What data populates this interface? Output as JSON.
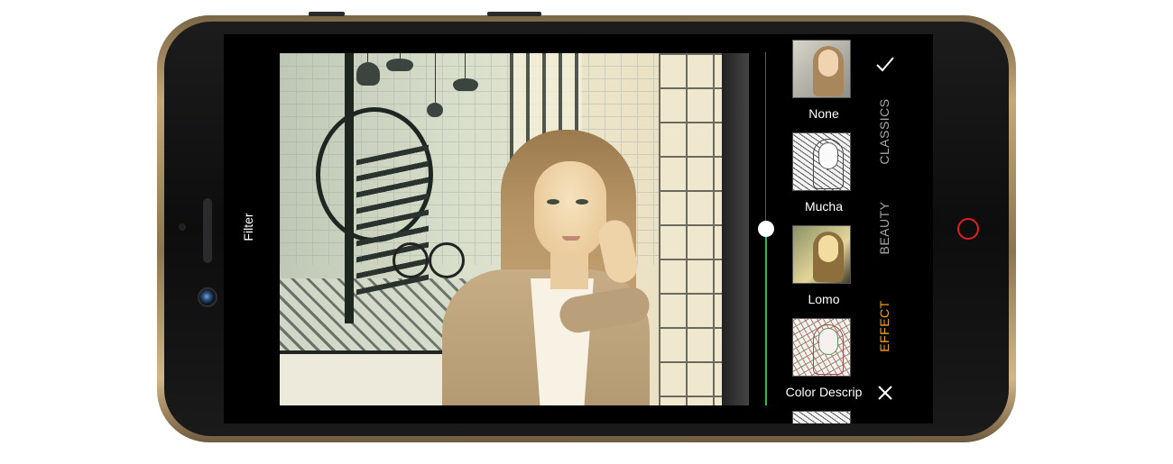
{
  "screen": {
    "title": "Filter"
  },
  "filters": {
    "items": [
      {
        "label": "None"
      },
      {
        "label": "Mucha"
      },
      {
        "label": "Lomo"
      },
      {
        "label": "Color Descrip"
      }
    ]
  },
  "categories": {
    "items": [
      {
        "label": "CLASSICS"
      },
      {
        "label": "BEAUTY"
      },
      {
        "label": "EFFECT"
      }
    ],
    "active": "EFFECT"
  },
  "slider": {
    "value": 0.5
  },
  "colors": {
    "active_category": "#f2a11d",
    "slider_fill": "#27c24a",
    "home_ring": "#e01e24"
  },
  "icons": {
    "confirm": "check-icon",
    "cancel": "close-icon"
  }
}
